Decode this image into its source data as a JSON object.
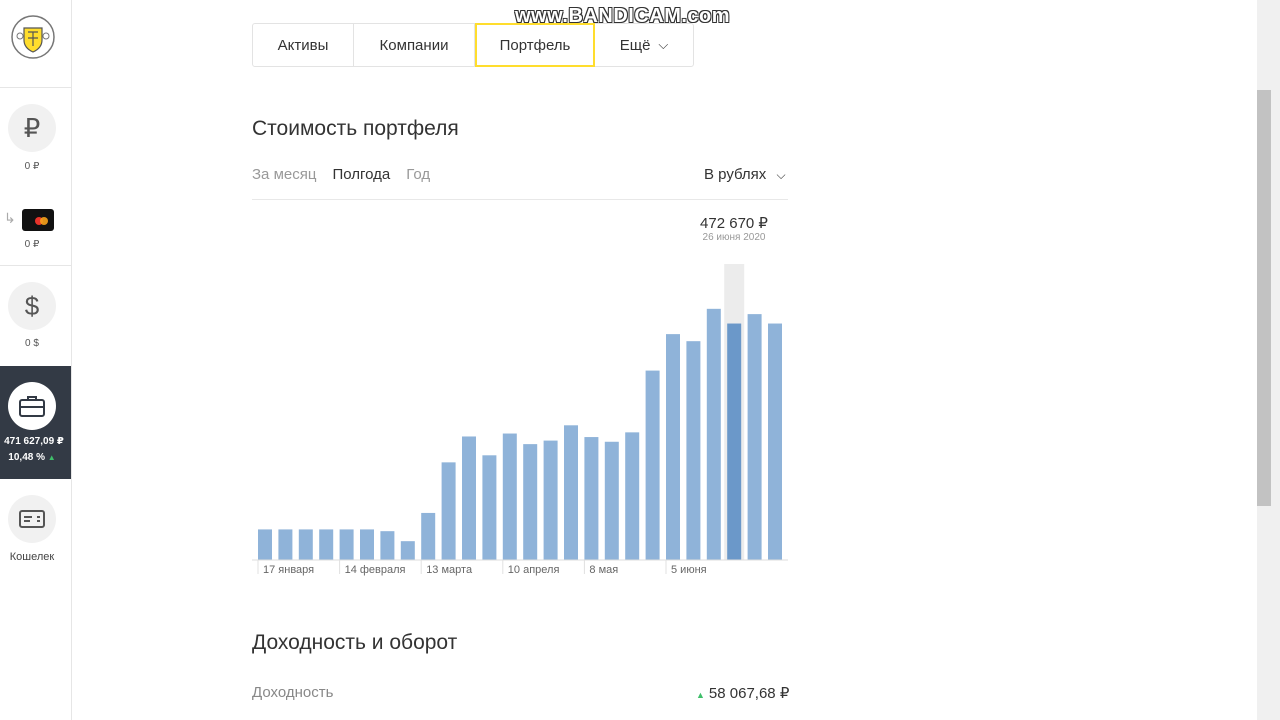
{
  "watermark": "www.BANDICAM.com",
  "sidebar": {
    "rub_amount": "0 ₽",
    "card_amount": "0 ₽",
    "usd_amount": "0 $",
    "portfolio_value": "471 627,09 ₽",
    "portfolio_change": "10,48 %",
    "wallet_label": "Кошелек"
  },
  "tabs": [
    {
      "label": "Активы"
    },
    {
      "label": "Компании"
    },
    {
      "label": "Портфель",
      "active": true
    },
    {
      "label": "Ещё"
    }
  ],
  "portfolio": {
    "title": "Стоимость портфеля",
    "periods": [
      "За месяц",
      "Полгода",
      "Год"
    ],
    "active_period": "Полгода",
    "currency_label": "В рублях",
    "tooltip_value": "472 670 ₽",
    "tooltip_date": "26 июня 2020"
  },
  "chart_data": {
    "type": "bar",
    "x_tick_labels": [
      "17 января",
      "14 февраля",
      "13 марта",
      "10 апреля",
      "8 мая",
      "5 июня"
    ],
    "values": [
      52000,
      52000,
      52000,
      52000,
      52000,
      52000,
      49000,
      32000,
      80000,
      166000,
      210000,
      178000,
      215000,
      197000,
      203000,
      229000,
      209000,
      201000,
      217000,
      322000,
      384000,
      372000,
      427000,
      402000,
      418000,
      402000
    ],
    "highlighted_index": 23,
    "highlighted_value": 472670,
    "highlighted_label": "26 июня 2020",
    "ylim": [
      0,
      510000
    ],
    "colors": {
      "bar": "#8fb3d9",
      "highlight": "#6b98c9",
      "hover_bg": "#ececec"
    }
  },
  "yield_section": {
    "title": "Доходность и оборот",
    "yield_label": "Доходность",
    "yield_value": "58 067,68 ₽"
  }
}
